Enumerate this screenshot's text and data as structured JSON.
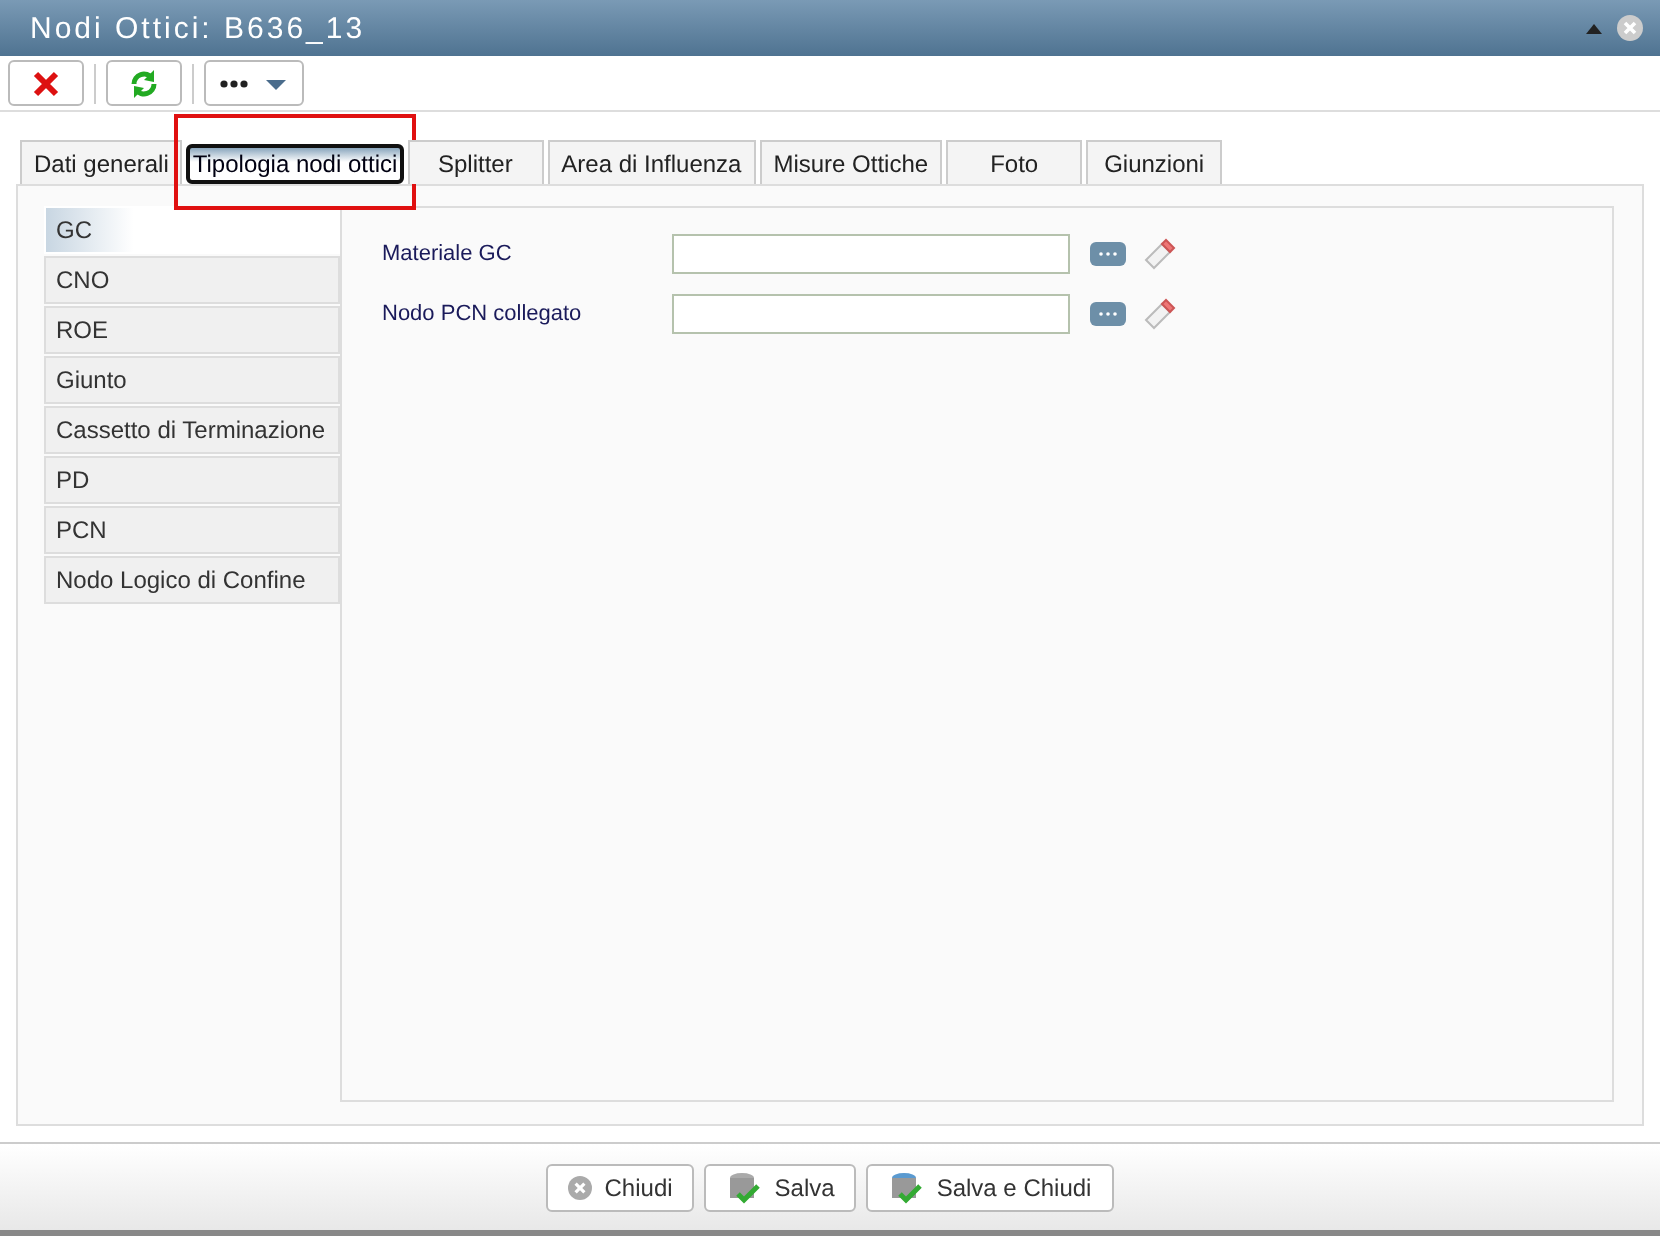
{
  "window": {
    "title": "Nodi Ottici: B636_13"
  },
  "tabs": [
    {
      "label": "Dati generali",
      "selected": false,
      "highlighted": false
    },
    {
      "label": "Tipologia nodi ottici",
      "selected": true,
      "highlighted": true
    },
    {
      "label": "Splitter",
      "selected": false,
      "highlighted": false
    },
    {
      "label": "Area di Influenza",
      "selected": false,
      "highlighted": false
    },
    {
      "label": "Misure Ottiche",
      "selected": false,
      "highlighted": false
    },
    {
      "label": "Foto",
      "selected": false,
      "highlighted": false
    },
    {
      "label": "Giunzioni",
      "selected": false,
      "highlighted": false
    }
  ],
  "types": [
    {
      "label": "GC",
      "selected": true
    },
    {
      "label": "CNO",
      "selected": false
    },
    {
      "label": "ROE",
      "selected": false
    },
    {
      "label": "Giunto",
      "selected": false
    },
    {
      "label": "Cassetto di Terminazione",
      "selected": false
    },
    {
      "label": "PD",
      "selected": false
    },
    {
      "label": "PCN",
      "selected": false
    },
    {
      "label": "Nodo Logico di Confine",
      "selected": false
    }
  ],
  "fields": [
    {
      "label": "Materiale GC"
    },
    {
      "label": "Nodo PCN collegato"
    }
  ],
  "buttons": [
    {
      "label": "Chiudi",
      "kind": "close"
    },
    {
      "label": "Salva",
      "kind": "save"
    },
    {
      "label": "Salva e Chiudi",
      "kind": "saveclose"
    }
  ]
}
